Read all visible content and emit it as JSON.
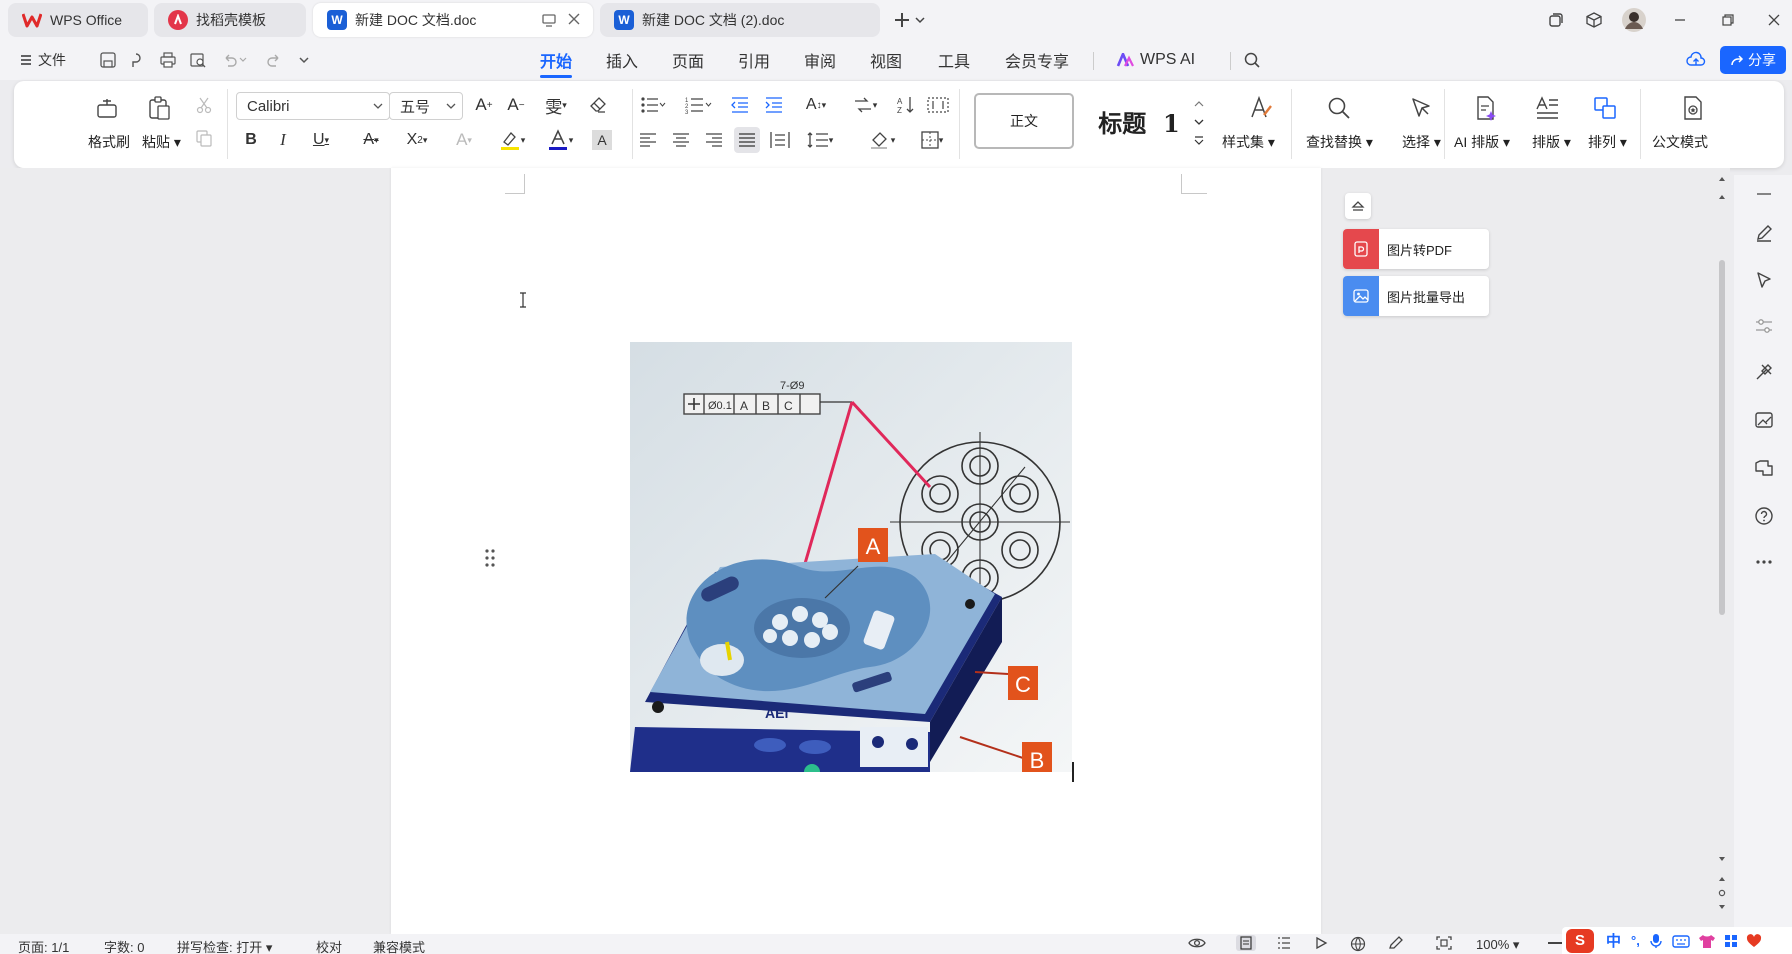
{
  "tabs": [
    {
      "label": "WPS Office",
      "icon": "wps-logo"
    },
    {
      "label": "找稻壳模板",
      "icon": "docer-logo"
    },
    {
      "label": "新建 DOC 文档.doc",
      "icon": "word-doc-icon"
    },
    {
      "label": "新建 DOC 文档 (2).doc",
      "icon": "word-doc-icon"
    }
  ],
  "menu": {
    "file_label": "文件",
    "items": [
      "开始",
      "插入",
      "页面",
      "引用",
      "审阅",
      "视图",
      "工具",
      "会员专享"
    ],
    "active": "开始",
    "ai_label": "WPS AI",
    "share_label": "分享"
  },
  "ribbon": {
    "format_painter": "格式刷",
    "paste": "粘贴",
    "font_name": "Calibri",
    "font_size": "五号",
    "style_normal": "正文",
    "style_heading": "标题  1",
    "style_set": "样式集",
    "find_replace": "查找替换",
    "select": "选择",
    "ai_layout": "AI 排版",
    "layout": "排版",
    "arrange": "排列",
    "official_mode": "公文模式"
  },
  "float_panel": {
    "img_to_pdf": "图片转PDF",
    "img_batch_export": "图片批量导出"
  },
  "image_labels": {
    "a": "A",
    "b": "B",
    "c": "C",
    "dim_text": "7-Ø9",
    "tol_text": "Ø0.1"
  },
  "status": {
    "page": "页面: 1/1",
    "words": "字数: 0",
    "spell": "拼写检查: 打开",
    "proof": "校对",
    "compat": "兼容模式",
    "zoom": "100%"
  },
  "ime": {
    "lang": "中",
    "punct": "°,"
  },
  "colors": {
    "accent": "#1a66ff",
    "wps_red": "#e02a2a",
    "word_blue": "#1a5fd6",
    "pdf_red": "#e5484d",
    "export_blue": "#4a8cf0",
    "label_orange": "#e2531c"
  }
}
